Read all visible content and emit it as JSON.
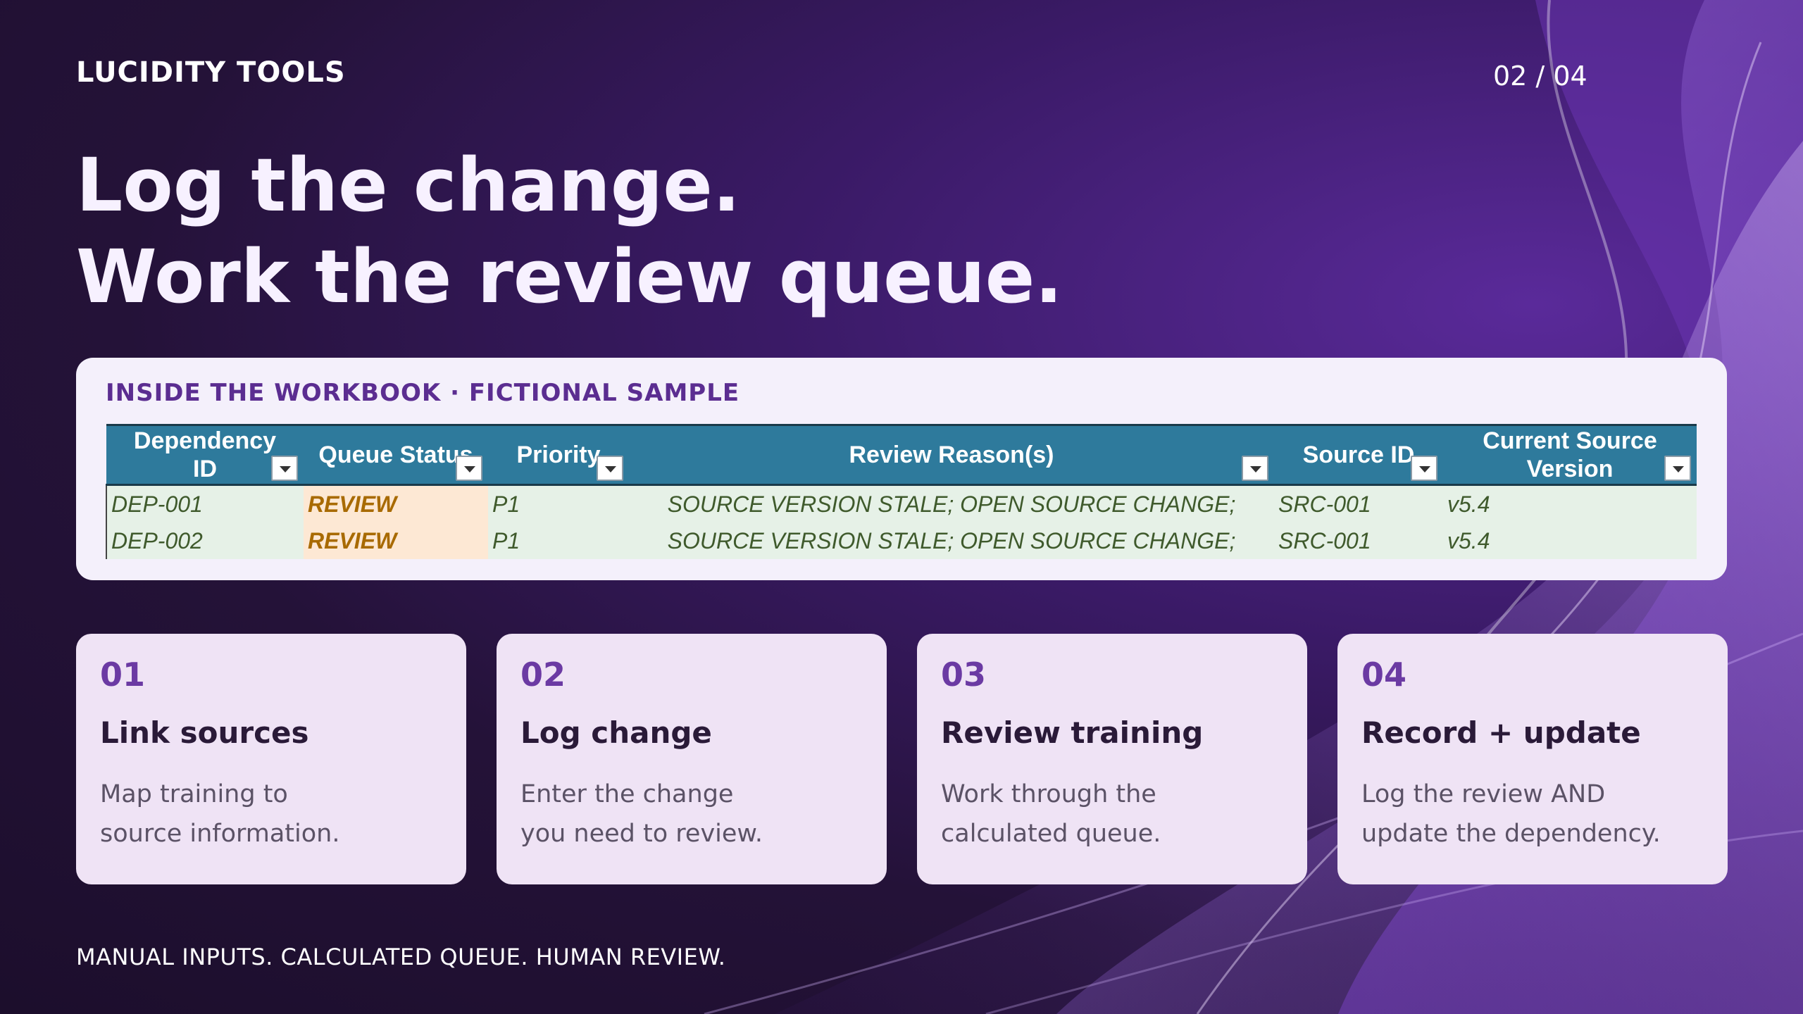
{
  "brand": "LUCIDITY TOOLS",
  "page_counter": "02 / 04",
  "headline": [
    "Log the change.",
    "Work the review queue."
  ],
  "workbook": {
    "label": "INSIDE THE WORKBOOK · FICTIONAL SAMPLE",
    "columns": [
      {
        "line1": "Dependency",
        "line2": "ID"
      },
      {
        "line1": "Queue Status",
        "line2": ""
      },
      {
        "line1": "Priority",
        "line2": ""
      },
      {
        "line1": "Review Reason(s)",
        "line2": ""
      },
      {
        "line1": "Source ID",
        "line2": ""
      },
      {
        "line1": "Current Source",
        "line2": "Version"
      }
    ],
    "rows": [
      [
        "DEP-001",
        "REVIEW",
        "P1",
        "SOURCE VERSION STALE; OPEN SOURCE CHANGE;",
        "SRC-001",
        "v5.4"
      ],
      [
        "DEP-002",
        "REVIEW",
        "P1",
        "SOURCE VERSION STALE; OPEN SOURCE CHANGE;",
        "SRC-001",
        "v5.4"
      ]
    ]
  },
  "steps": [
    {
      "num": "01",
      "title": "Link sources",
      "desc": "Map training to\nsource information."
    },
    {
      "num": "02",
      "title": "Log change",
      "desc": "Enter the change\nyou need to review."
    },
    {
      "num": "03",
      "title": "Review training",
      "desc": "Work through the\ncalculated queue."
    },
    {
      "num": "04",
      "title": "Record + update",
      "desc": "Log the review AND\nupdate the dependency."
    }
  ],
  "footer": "MANUAL INPUTS. CALCULATED QUEUE. HUMAN REVIEW.",
  "colors": {
    "header_fill": "#2e7a9c",
    "row_fill": "#e6f1e7",
    "status_fill": "#fde8d4",
    "accent": "#6b3aa3"
  }
}
